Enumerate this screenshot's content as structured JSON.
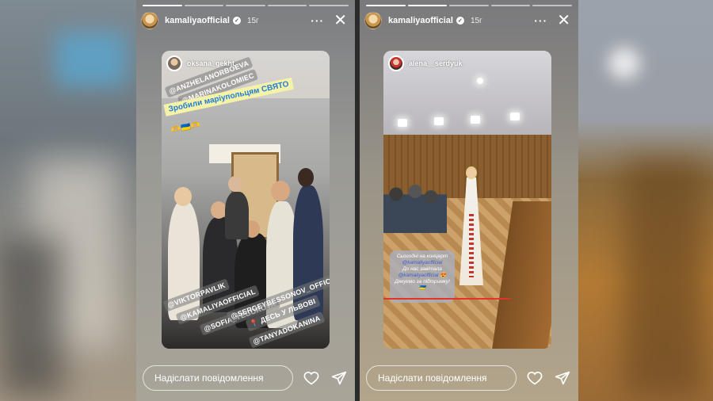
{
  "story1": {
    "username": "kamaliyaofficial",
    "time": "15г",
    "more": "···",
    "close": "✕",
    "repost": {
      "username": "oksana_gekht",
      "banner": "Зробили маріупольцям СВЯТО",
      "banner_emoji": "🫶🇺🇦🫶",
      "tags_top": [
        "@ANZHELANORBOEVA",
        "@MARINAKOLOMIEC"
      ],
      "tags_bottom": [
        "@VIKTORPAVLIK",
        "@KAMALIYAOFFICIAL",
        "@SOFIA_YEGOROVA",
        "@SERGEYBESSONOV_OFFICIAL",
        "📍 ДЕСЬ У ЛЬВОВІ",
        "@TANYADOKANINA"
      ]
    },
    "message_placeholder": "Надіслати повідомлення"
  },
  "story2": {
    "username": "kamaliyaofficial",
    "time": "15г",
    "more": "···",
    "close": "✕",
    "repost": {
      "username": "alena__serdyuk",
      "text_lines": [
        "Сьогодні на концерт",
        "@kamaliyaofficial",
        "До нас завітала",
        "@kamaliyaofficial 😍",
        "Дякуємо за підтримку!",
        "🇺🇦"
      ]
    },
    "message_placeholder": "Надіслати повідомлення"
  },
  "icons": {
    "like": "heart-icon",
    "share": "paper-plane-icon",
    "verified": "verified-badge-icon"
  }
}
